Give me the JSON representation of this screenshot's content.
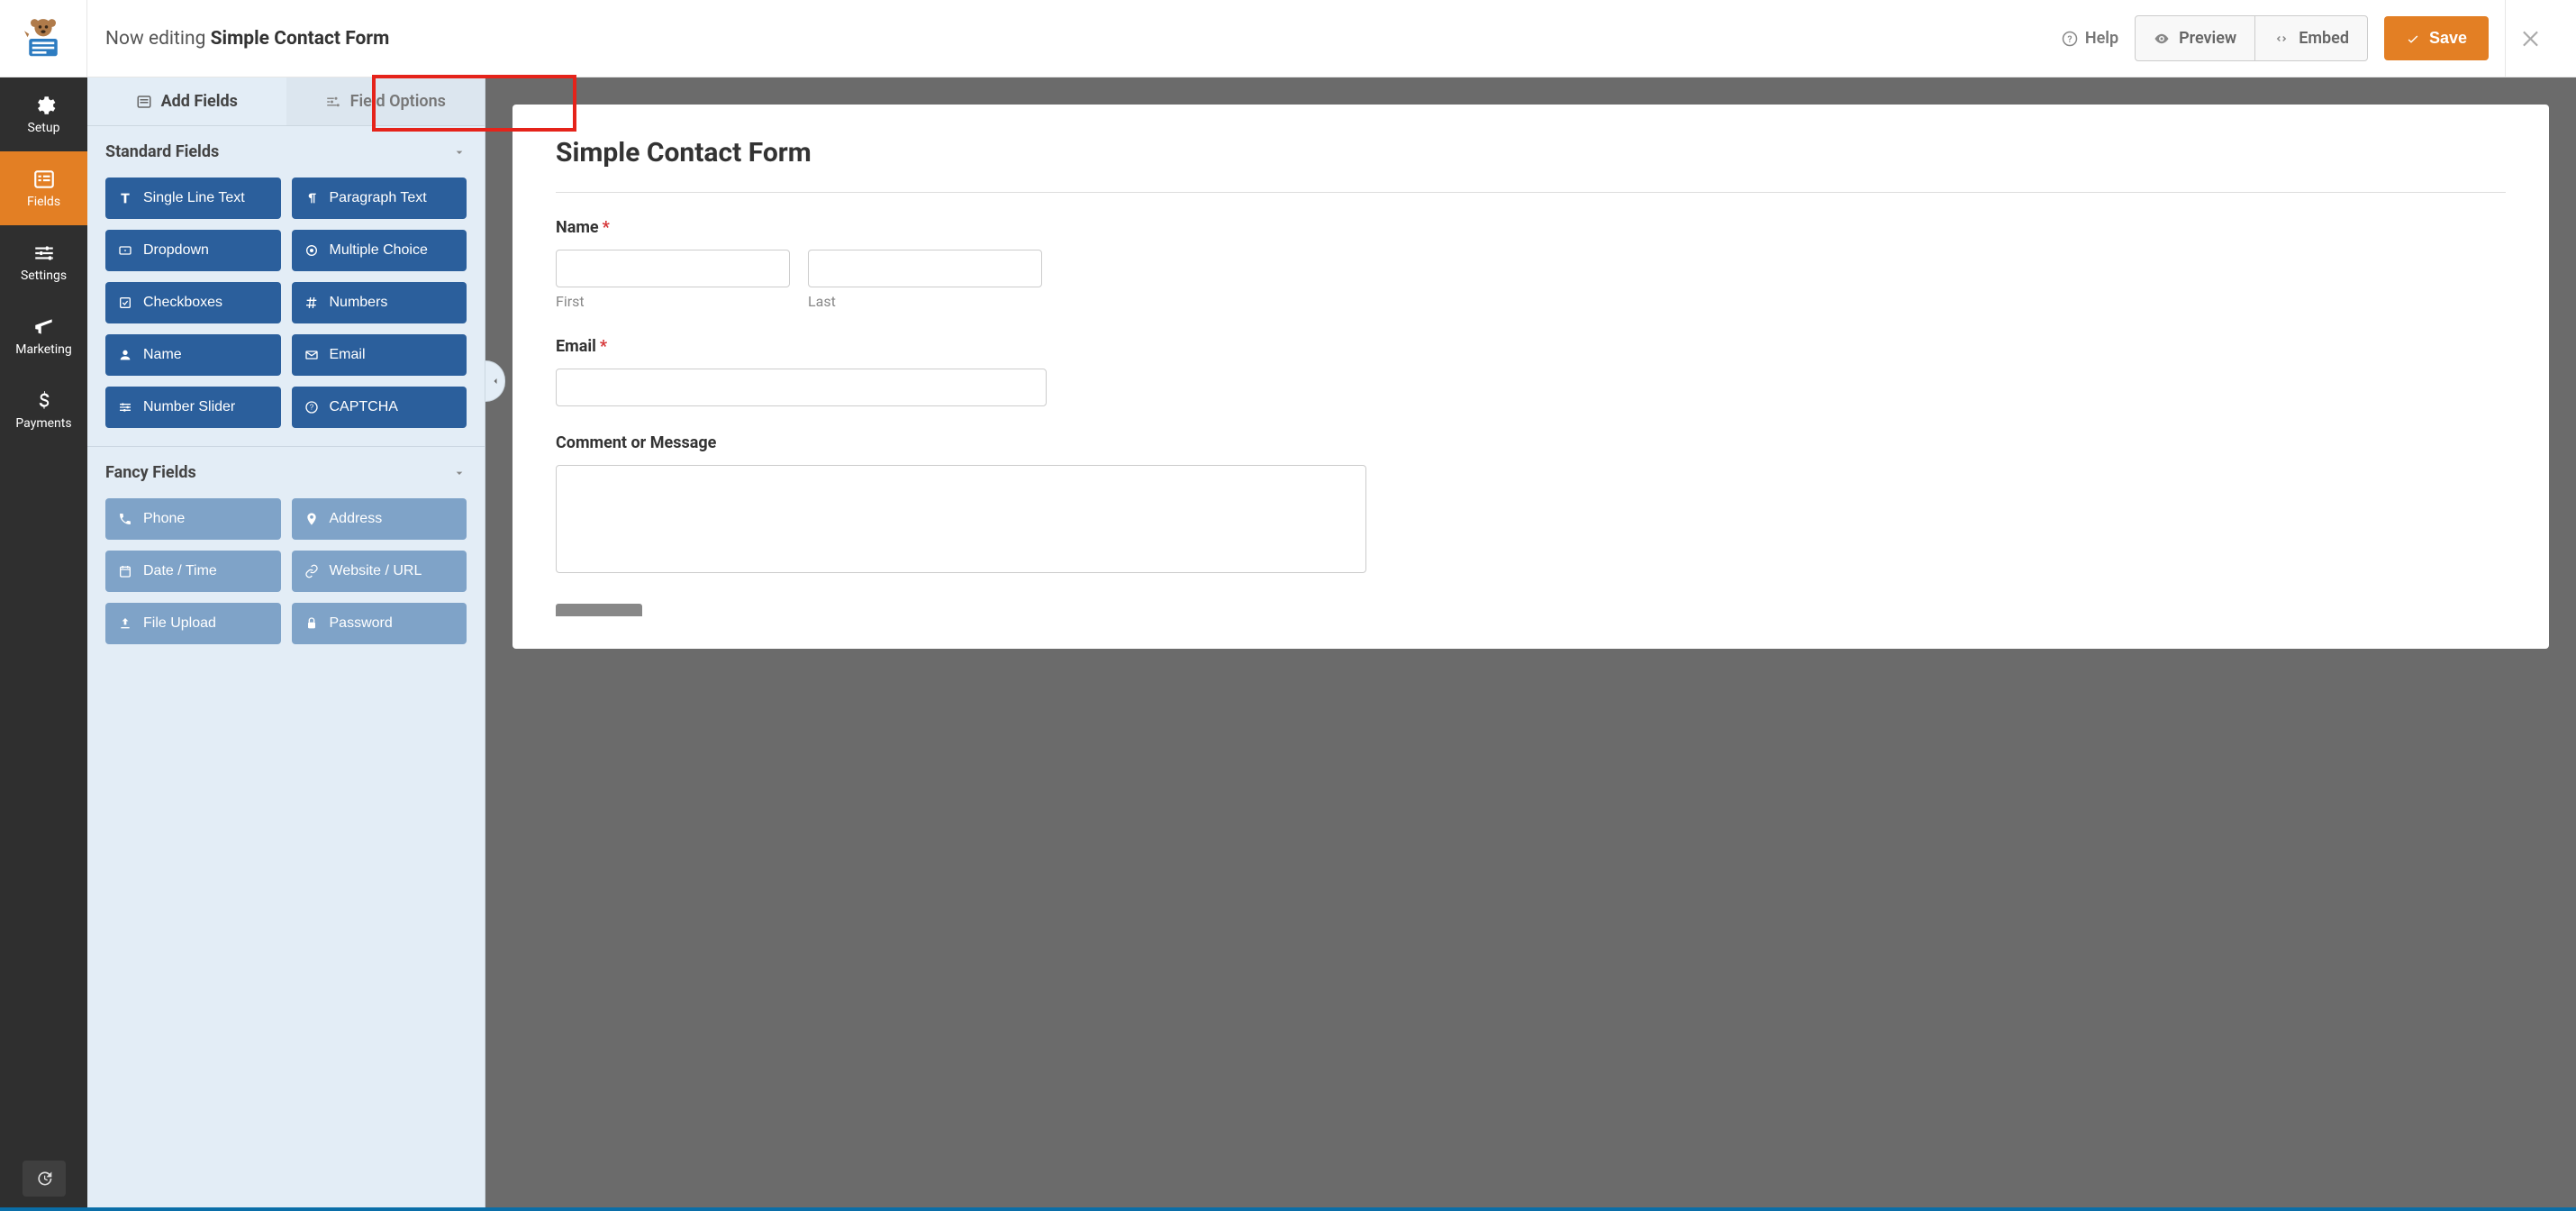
{
  "header": {
    "prefix": "Now editing",
    "form_name": "Simple Contact Form",
    "help": "Help",
    "preview": "Preview",
    "embed": "Embed",
    "save": "Save"
  },
  "sidenav": {
    "setup": "Setup",
    "fields": "Fields",
    "settings": "Settings",
    "marketing": "Marketing",
    "payments": "Payments"
  },
  "panel": {
    "tab_add": "Add Fields",
    "tab_options": "Field Options",
    "section_standard": "Standard Fields",
    "section_fancy": "Fancy Fields",
    "standard": {
      "single_line": "Single Line Text",
      "paragraph": "Paragraph Text",
      "dropdown": "Dropdown",
      "multiple_choice": "Multiple Choice",
      "checkboxes": "Checkboxes",
      "numbers": "Numbers",
      "name": "Name",
      "email": "Email",
      "number_slider": "Number Slider",
      "captcha": "CAPTCHA"
    },
    "fancy": {
      "phone": "Phone",
      "address": "Address",
      "date_time": "Date / Time",
      "website": "Website / URL",
      "file_upload": "File Upload",
      "password": "Password"
    }
  },
  "form": {
    "title": "Simple Contact Form",
    "name_label": "Name",
    "first_sub": "First",
    "last_sub": "Last",
    "email_label": "Email",
    "comment_label": "Comment or Message"
  }
}
